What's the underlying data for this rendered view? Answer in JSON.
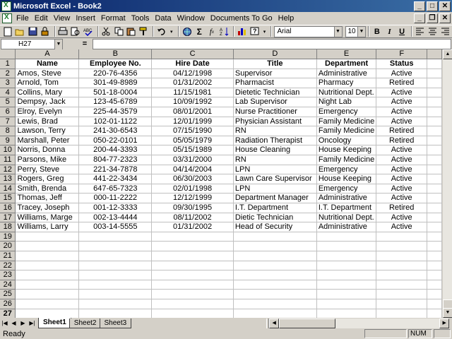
{
  "window": {
    "title": "Microsoft Excel - Book2",
    "min": "_",
    "max": "□",
    "close": "✕"
  },
  "menu": [
    "File",
    "Edit",
    "View",
    "Insert",
    "Format",
    "Tools",
    "Data",
    "Window",
    "Documents To Go",
    "Help"
  ],
  "doc_controls": {
    "min": "_",
    "restore": "❐",
    "close": "✕"
  },
  "toolbar": {
    "font": "Arial",
    "size": "10",
    "bold": "B",
    "italic": "I",
    "underline": "U",
    "icons": [
      "new-icon",
      "open-icon",
      "save-icon",
      "permission-icon",
      "print-icon",
      "print-preview-icon",
      "spelling-icon",
      "cut-icon",
      "copy-icon",
      "paste-icon",
      "format-painter-icon",
      "undo-icon",
      "hyperlink-icon",
      "autosum-icon",
      "function-icon",
      "sort-ascending-icon",
      "chart-wizard-icon",
      "help-icon"
    ]
  },
  "formula": {
    "name_box": "H27",
    "equals": "=",
    "value": ""
  },
  "columns": [
    "A",
    "B",
    "C",
    "D",
    "E",
    "F"
  ],
  "rows": [
    [
      "Name",
      "Employee No.",
      "Hire Date",
      "Title",
      "Department",
      "Status"
    ],
    [
      "Amos, Steve",
      "220-76-4356",
      "04/12/1998",
      "Supervisor",
      "Administrative",
      "Active"
    ],
    [
      "Arnold, Tom",
      "301-49-8989",
      "01/31/2002",
      "Pharmacist",
      "Pharmacy",
      "Retired"
    ],
    [
      "Collins, Mary",
      "501-18-0004",
      "11/15/1981",
      "Dietetic Technician",
      "Nutritional Dept.",
      "Active"
    ],
    [
      "Dempsy, Jack",
      "123-45-6789",
      "10/09/1992",
      "Lab Supervisor",
      "Night Lab",
      "Active"
    ],
    [
      "Elroy, Evelyn",
      "225-44-3579",
      "08/01/2001",
      "Nurse Practitioner",
      "Emergency",
      "Active"
    ],
    [
      "Lewis, Brad",
      "102-01-1122",
      "12/01/1999",
      "Physician Assistant",
      "Family Medicine",
      "Active"
    ],
    [
      "Lawson, Terry",
      "241-30-6543",
      "07/15/1990",
      "RN",
      "Family Medicine",
      "Retired"
    ],
    [
      "Marshall, Peter",
      "050-22-0101",
      "05/05/1979",
      "Radiation Therapist",
      "Oncology",
      "Retired"
    ],
    [
      "Norris, Donna",
      "200-44-3393",
      "05/15/1989",
      "House Cleaning",
      "House Keeping",
      "Active"
    ],
    [
      "Parsons, Mike",
      "804-77-2323",
      "03/31/2000",
      "RN",
      "Family Medicine",
      "Active"
    ],
    [
      "Perry, Steve",
      "221-34-7878",
      "04/14/2004",
      "LPN",
      "Emergency",
      "Active"
    ],
    [
      "Rogers, Greg",
      "441-22-3434",
      "06/30/2003",
      "Lawn Care Supervisor",
      "House Keeping",
      "Active"
    ],
    [
      "Smith, Brenda",
      "647-65-7323",
      "02/01/1998",
      "LPN",
      "Emergency",
      "Active"
    ],
    [
      "Thomas, Jeff",
      "000-11-2222",
      "12/12/1999",
      "Department Manager",
      "Administrative",
      "Active"
    ],
    [
      "Tracey, Joseph",
      "001-12-3333",
      "09/30/1995",
      "I.T. Department",
      "I.T. Department",
      "Retired"
    ],
    [
      "Williams, Marge",
      "002-13-4444",
      "08/11/2002",
      "Dietic Technician",
      "Nutritional Dept.",
      "Active"
    ],
    [
      "Williams, Larry",
      "003-14-5555",
      "01/31/2002",
      "Head of Security",
      "Administrative",
      "Active"
    ]
  ],
  "row_numbers": [
    "1",
    "2",
    "3",
    "4",
    "5",
    "6",
    "7",
    "8",
    "9",
    "10",
    "11",
    "12",
    "13",
    "14",
    "15",
    "16",
    "17",
    "18",
    "19",
    "20",
    "21",
    "22",
    "23",
    "24",
    "25",
    "26",
    "27"
  ],
  "sheets": [
    "Sheet1",
    "Sheet2",
    "Sheet3"
  ],
  "status": {
    "ready": "Ready",
    "num": "NUM"
  }
}
